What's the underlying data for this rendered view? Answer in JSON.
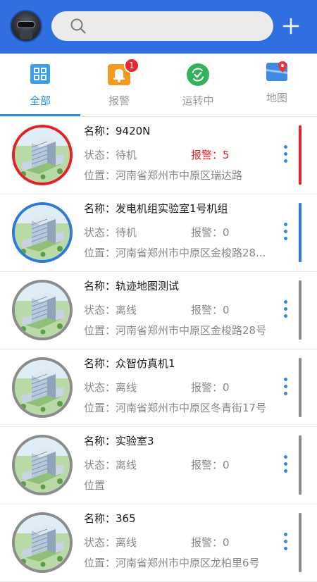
{
  "search": {
    "placeholder": ""
  },
  "tabs": [
    {
      "label": "全部",
      "icon": "grid-icon",
      "active": true
    },
    {
      "label": "报警",
      "icon": "bell-icon",
      "badge": "1"
    },
    {
      "label": "运转中",
      "icon": "running-check-icon"
    },
    {
      "label": "地图",
      "icon": "map-pin-icon"
    }
  ],
  "colors": {
    "header": "#2f6fe0",
    "accent": "#2f8ae0",
    "alarm": "#e0232a",
    "offline": "#8c8c8c",
    "online": "#2f7ad8"
  },
  "devices": [
    {
      "name": "名称：9420N",
      "state": "状态：待机",
      "alarm": "报警：5",
      "location": "位置：河南省郑州市中原区瑞达路",
      "status_color": "#e0232a",
      "alarm_hot": true
    },
    {
      "name": "名称：发电机组实验室1号机组",
      "state": "状态：待机",
      "alarm": "报警：0",
      "location": "位置：河南省郑州市中原区金梭路28...",
      "status_color": "#2f7ad8",
      "alarm_hot": false
    },
    {
      "name": "名称：轨迹地图测试",
      "state": "状态：离线",
      "alarm": "报警：0",
      "location": "位置：河南省郑州市中原区金梭路28号",
      "status_color": "#8c8c8c",
      "alarm_hot": false
    },
    {
      "name": "名称：众智仿真机1",
      "state": "状态：离线",
      "alarm": "报警：0",
      "location": "位置：河南省郑州市中原区冬青街17号",
      "status_color": "#8c8c8c",
      "alarm_hot": false
    },
    {
      "name": "名称：实验室3",
      "state": "状态：离线",
      "alarm": "报警：0",
      "location": "位置",
      "status_color": "#8c8c8c",
      "alarm_hot": false
    },
    {
      "name": "名称：365",
      "state": "状态：离线",
      "alarm": "报警：0",
      "location": "位置：河南省郑州市中原区龙柏里6号",
      "status_color": "#8c8c8c",
      "alarm_hot": false
    }
  ]
}
